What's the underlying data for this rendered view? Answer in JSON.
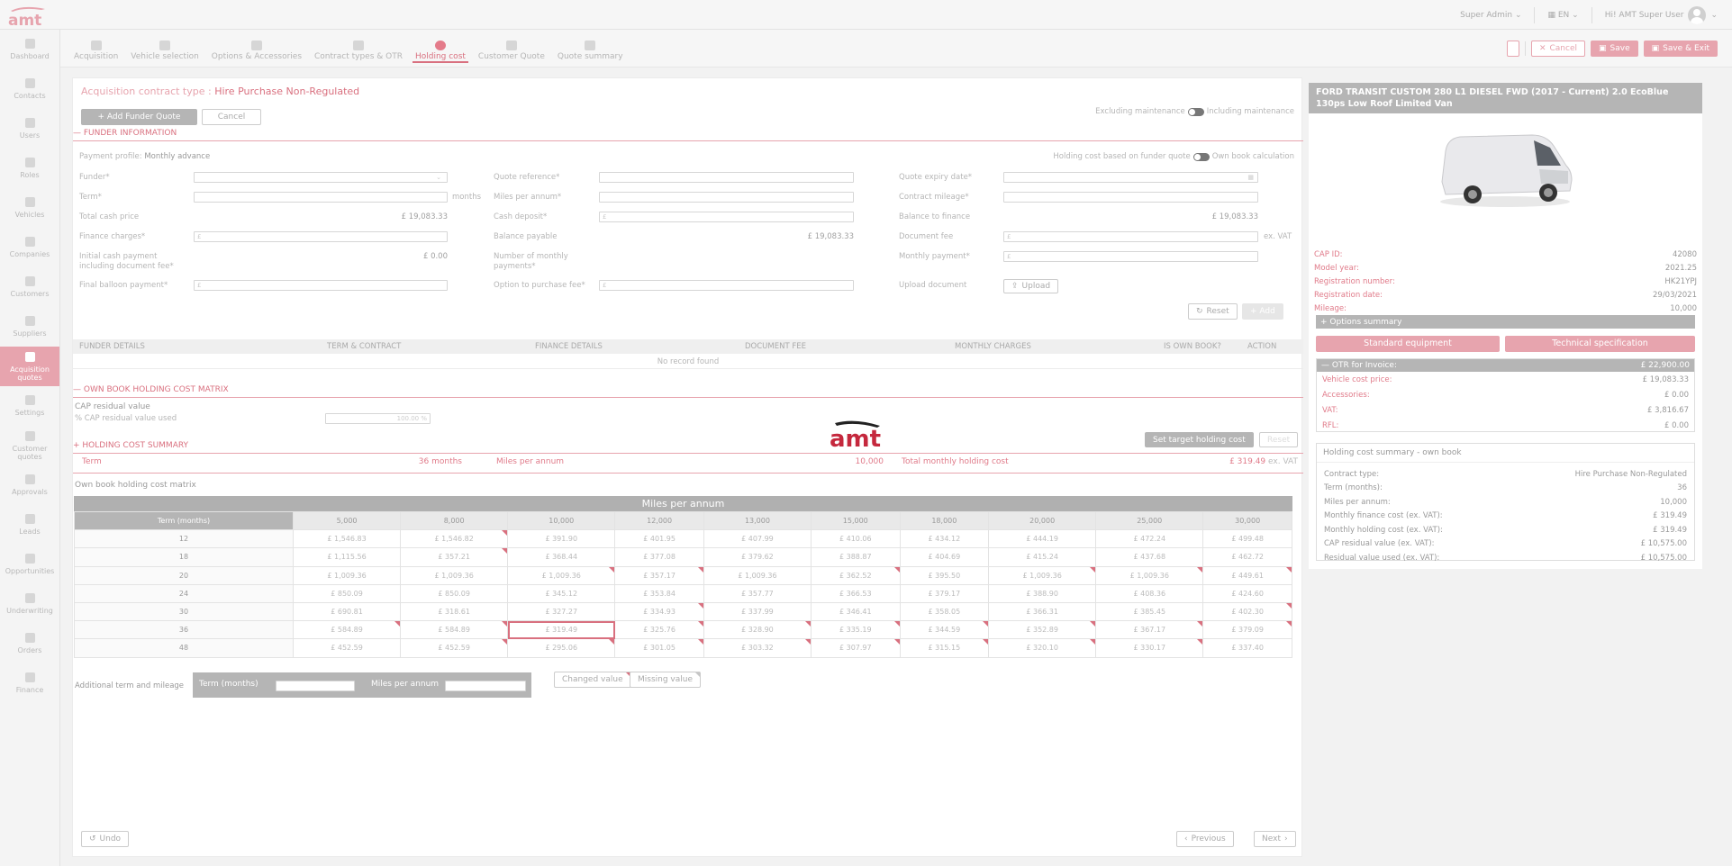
{
  "header": {
    "role_selector": "Super Admin",
    "language": "EN",
    "greeting": "Hi! AMT Super User"
  },
  "sidebar": {
    "items": [
      {
        "label": "Dashboard"
      },
      {
        "label": "Contacts"
      },
      {
        "label": "Users"
      },
      {
        "label": "Roles"
      },
      {
        "label": "Vehicles"
      },
      {
        "label": "Companies"
      },
      {
        "label": "Customers"
      },
      {
        "label": "Suppliers"
      },
      {
        "label": "Acquisition quotes"
      },
      {
        "label": "Settings"
      },
      {
        "label": "Customer quotes"
      },
      {
        "label": "Approvals"
      },
      {
        "label": "Leads"
      },
      {
        "label": "Opportunities"
      },
      {
        "label": "Underwriting"
      },
      {
        "label": "Orders"
      },
      {
        "label": "Finance"
      }
    ]
  },
  "steps": [
    {
      "label": "Acquisition"
    },
    {
      "label": "Vehicle selection"
    },
    {
      "label": "Options & Accessories"
    },
    {
      "label": "Contract types & OTR"
    },
    {
      "label": "Holding cost"
    },
    {
      "label": "Customer Quote"
    },
    {
      "label": "Quote summary"
    }
  ],
  "toolbar": {
    "cancel": "Cancel",
    "save": "Save",
    "save_exit": "Save & Exit"
  },
  "contract": {
    "title_prefix": "Acquisition contract type :",
    "title_value": "Hire Purchase Non-Regulated",
    "add_funder": "+ Add Funder Quote",
    "cancel": "Cancel",
    "excl_maint": "Excluding maintenance",
    "incl_maint": "Including maintenance"
  },
  "funder": {
    "section": "FUNDER INFORMATION",
    "payment_profile_label": "Payment profile:",
    "payment_profile_value": "Monthly advance",
    "based_on_funder": "Holding cost based on funder quote",
    "own_book": "Own book calculation",
    "fields": {
      "funder": "Funder*",
      "quote_ref": "Quote reference*",
      "quote_expiry": "Quote expiry date*",
      "term": "Term*",
      "months": "months",
      "miles": "Miles per annum*",
      "contract_mileage": "Contract mileage*",
      "total_cash": "Total cash price",
      "total_cash_value": "£ 19,083.33",
      "cash_deposit": "Cash deposit*",
      "balance_finance": "Balance to finance",
      "balance_finance_value": "£ 19,083.33",
      "finance_charges": "Finance charges*",
      "balance_payable": "Balance payable",
      "balance_payable_value": "£ 19,083.33",
      "document_fee": "Document fee",
      "ex_vat": "ex. VAT",
      "initial_cash": "Initial cash payment including document fee*",
      "initial_cash_value": "£ 0.00",
      "num_monthly": "Number of monthly payments*",
      "monthly_payment": "Monthly payment*",
      "final_balloon": "Final balloon payment*",
      "option_purchase": "Option to purchase fee*",
      "upload_doc": "Upload document",
      "upload": "Upload",
      "currency": "£"
    },
    "reset": "Reset",
    "add": "+ Add"
  },
  "funder_table": {
    "columns": [
      "FUNDER DETAILS",
      "TERM & CONTRACT",
      "FINANCE DETAILS",
      "DOCUMENT FEE",
      "MONTHLY CHARGES",
      "IS OWN BOOK?",
      "ACTION"
    ],
    "empty": "No record found"
  },
  "ownbook": {
    "section": "OWN BOOK HOLDING COST MATRIX",
    "cap_residual": "CAP residual value",
    "cap_used": "% CAP residual value used",
    "cap_used_value": "100.00 %"
  },
  "summary": {
    "section": "HOLDING COST SUMMARY",
    "term_label": "Term",
    "term_value": "36 months",
    "miles_label": "Miles per annum",
    "miles_value": "10,000",
    "total_label": "Total monthly holding cost",
    "total_value": "£ 319.49",
    "ex_vat": "ex. VAT",
    "set_target": "Set target holding cost",
    "reset": "Reset"
  },
  "matrix": {
    "title": "Own book holding cost matrix",
    "header": "Miles per annum",
    "term_header": "Term (months)",
    "miles": [
      "5,000",
      "8,000",
      "10,000",
      "12,000",
      "13,000",
      "15,000",
      "18,000",
      "20,000",
      "25,000",
      "30,000"
    ],
    "rows": [
      {
        "term": "12",
        "values": [
          "£ 1,546.83",
          "£ 1,546.82",
          "£ 391.90",
          "£ 401.95",
          "£ 407.99",
          "£ 410.06",
          "£ 434.12",
          "£ 444.19",
          "£ 472.24",
          "£ 499.48"
        ]
      },
      {
        "term": "18",
        "values": [
          "£ 1,115.56",
          "£ 357.21",
          "£ 368.44",
          "£ 377.08",
          "£ 379.62",
          "£ 388.87",
          "£ 404.69",
          "£ 415.24",
          "£ 437.68",
          "£ 462.72"
        ]
      },
      {
        "term": "20",
        "values": [
          "£ 1,009.36",
          "£ 1,009.36",
          "£ 1,009.36",
          "£ 357.17",
          "£ 1,009.36",
          "£ 362.52",
          "£ 395.50",
          "£ 1,009.36",
          "£ 1,009.36",
          "£ 449.61"
        ]
      },
      {
        "term": "24",
        "values": [
          "£ 850.09",
          "£ 850.09",
          "£ 345.12",
          "£ 353.84",
          "£ 357.77",
          "£ 366.53",
          "£ 379.17",
          "£ 388.90",
          "£ 408.36",
          "£ 424.60"
        ]
      },
      {
        "term": "30",
        "values": [
          "£ 690.81",
          "£ 318.61",
          "£ 327.27",
          "£ 334.93",
          "£ 337.99",
          "£ 346.41",
          "£ 358.05",
          "£ 366.31",
          "£ 385.45",
          "£ 402.30"
        ]
      },
      {
        "term": "36",
        "values": [
          "£ 584.89",
          "£ 584.89",
          "£ 319.49",
          "£ 325.76",
          "£ 328.90",
          "£ 335.19",
          "£ 344.59",
          "£ 352.89",
          "£ 367.17",
          "£ 379.09"
        ]
      },
      {
        "term": "48",
        "values": [
          "£ 452.59",
          "£ 452.59",
          "£ 295.06",
          "£ 301.05",
          "£ 303.32",
          "£ 307.97",
          "£ 315.15",
          "£ 320.10",
          "£ 330.17",
          "£ 337.40"
        ]
      }
    ],
    "additional_label": "Additional term and mileage",
    "add_term": "Term (months)",
    "add_miles": "Miles per annum",
    "changed": "Changed value",
    "missing": "Missing value"
  },
  "footer": {
    "undo": "Undo",
    "previous": "Previous",
    "next": "Next"
  },
  "vehicle": {
    "name": "FORD TRANSIT CUSTOM 280 L1 DIESEL FWD (2017 - Current) 2.0 EcoBlue 130ps Low Roof Limited Van",
    "details": [
      {
        "k": "CAP ID:",
        "v": "42080"
      },
      {
        "k": "Model year:",
        "v": "2021.25"
      },
      {
        "k": "Registration number:",
        "v": "HK21YPJ"
      },
      {
        "k": "Registration date:",
        "v": "29/03/2021"
      },
      {
        "k": "Mileage:",
        "v": "10,000"
      }
    ],
    "options_summary": "+ Options summary",
    "standard_equipment": "Standard equipment",
    "technical_spec": "Technical specification",
    "otr_label": "— OTR for Invoice:",
    "otr_value": "£ 22,900.00",
    "otr_rows": [
      {
        "k": "Vehicle cost price:",
        "v": "£ 19,083.33"
      },
      {
        "k": "Accessories:",
        "v": "£ 0.00"
      },
      {
        "k": "VAT:",
        "v": "£ 3,816.67"
      },
      {
        "k": "RFL:",
        "v": "£ 0.00"
      }
    ],
    "summary_title": "Holding cost summary - own book",
    "summary_rows": [
      {
        "k": "Contract type:",
        "v": "Hire Purchase Non-Regulated"
      },
      {
        "k": "Term (months):",
        "v": "36"
      },
      {
        "k": "Miles per annum:",
        "v": "10,000"
      },
      {
        "k": "Monthly finance cost (ex. VAT):",
        "v": "£ 319.49"
      },
      {
        "k": "Monthly holding cost (ex. VAT):",
        "v": "£ 319.49"
      },
      {
        "k": "CAP residual value (ex. VAT):",
        "v": "£ 10,575.00"
      },
      {
        "k": "Residual value used (ex. VAT):",
        "v": "£ 10,575.00"
      }
    ]
  },
  "loader_logo": "amt",
  "app_logo": "amt"
}
